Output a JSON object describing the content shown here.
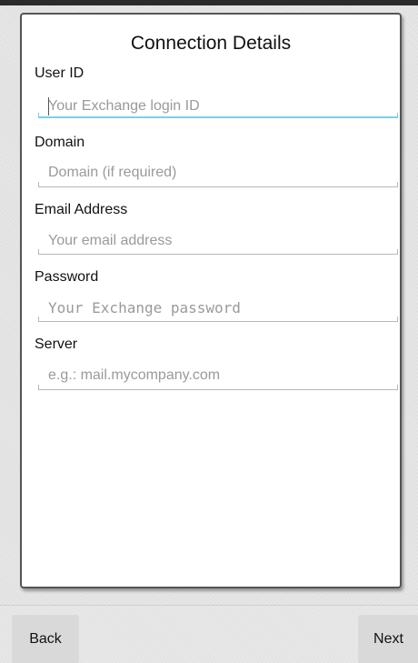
{
  "form": {
    "title": "Connection Details",
    "fields": [
      {
        "label": "User ID",
        "placeholder": "Your Exchange login ID",
        "value": ""
      },
      {
        "label": "Domain",
        "placeholder": "Domain (if required)",
        "value": ""
      },
      {
        "label": "Email Address",
        "placeholder": "Your email address",
        "value": ""
      },
      {
        "label": "Password",
        "placeholder": "Your Exchange password",
        "value": ""
      },
      {
        "label": "Server",
        "placeholder": "e.g.: mail.mycompany.com",
        "value": ""
      }
    ]
  },
  "footer": {
    "back_label": "Back",
    "next_label": "Next"
  },
  "colors": {
    "focus_accent": "#7ad0ea",
    "card_border": "#555555"
  }
}
